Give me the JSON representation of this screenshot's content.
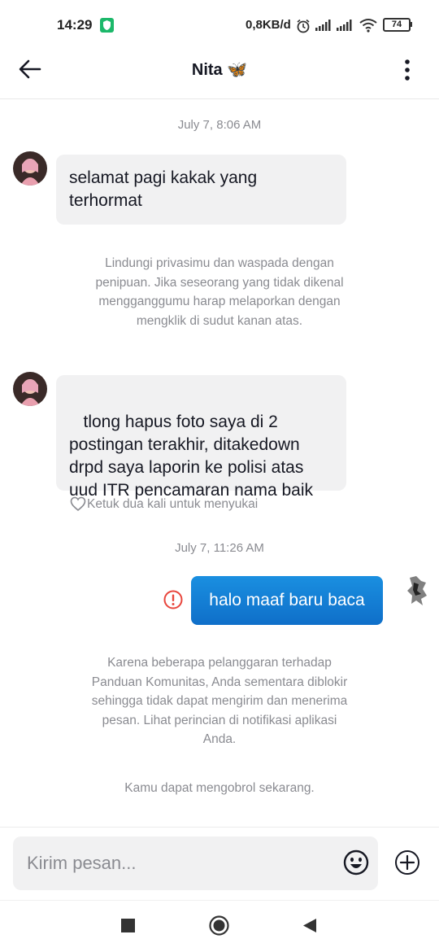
{
  "status_bar": {
    "time": "14:29",
    "net_speed": "0,8KB/d",
    "battery": "74"
  },
  "header": {
    "title": "Nita 🦋"
  },
  "messages": {
    "ts1": "July 7, 8:06 AM",
    "msg1": "selamat pagi kakak yang terhormat",
    "sys1": "Lindungi privasimu dan waspada dengan penipuan. Jika seseorang yang tidak dikenal mengganggumu harap melaporkan dengan mengklik di sudut kanan atas.",
    "msg2": " tlong hapus foto saya di 2 postingan terakhir, ditakedown drpd saya laporin ke polisi atas uud ITR pencamaran nama baik",
    "like_hint": "Ketuk dua kali untuk menyukai",
    "ts2": "July 7, 11:26 AM",
    "out1": "halo maaf baru baca",
    "sys2": "Karena beberapa pelanggaran terhadap Panduan Komunitas, Anda sementara diblokir sehingga tidak dapat mengirim dan menerima pesan. Lihat perincian di notifikasi aplikasi Anda.",
    "sys3": "Kamu dapat mengobrol sekarang."
  },
  "composer": {
    "placeholder": "Kirim pesan..."
  },
  "colors": {
    "accent_blue": "#1480d8",
    "error_red": "#e8453c",
    "bubble_gray": "#f1f1f2",
    "muted_text": "#8a8b91"
  },
  "icons": [
    "back-arrow-icon",
    "more-vertical-icon",
    "heart-icon",
    "error-icon",
    "emoji-icon",
    "plus-circle-icon"
  ]
}
